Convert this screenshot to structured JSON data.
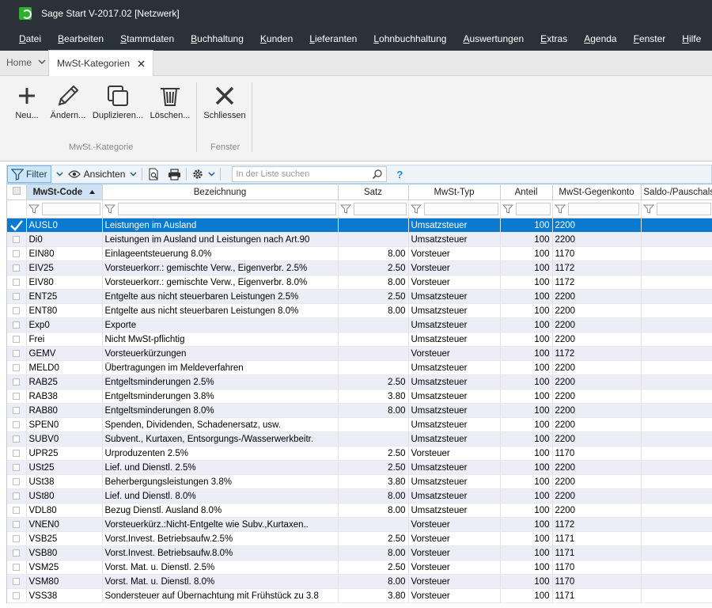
{
  "window": {
    "title": "Sage Start V-2017.02 [Netzwerk]"
  },
  "menu": [
    "Datei",
    "Bearbeiten",
    "Stammdaten",
    "Buchhaltung",
    "Kunden",
    "Lieferanten",
    "Lohnbuchhaltung",
    "Auswertungen",
    "Extras",
    "Agenda",
    "Fenster",
    "Hilfe"
  ],
  "tabs": {
    "home": "Home",
    "active": "MwSt-Kategorien"
  },
  "ribbon": {
    "new_label": "Neu...",
    "edit_label": "Ändern...",
    "duplicate_label": "Duplizieren...",
    "delete_label": "Löschen...",
    "close_label": "Schliessen",
    "group1": "MwSt.-Kategorie",
    "group2": "Fenster"
  },
  "toolbar": {
    "filter_label": "Filter",
    "views_label": "Ansichten",
    "search_placeholder": "In der Liste suchen",
    "help": "?"
  },
  "columns": [
    "MwSt-Code",
    "Bezeichnung",
    "Satz",
    "MwSt-Typ",
    "Anteil",
    "MwSt-Gegenkonto",
    "Saldo-/Pauschalst"
  ],
  "rows": [
    {
      "code": "AUSL0",
      "desc": "Leistungen im Ausland",
      "rate": "",
      "type": "Umsatzsteuer",
      "share": "100",
      "account": "2200"
    },
    {
      "code": "Di0",
      "desc": "Leistungen im Ausland und Leistungen nach Art.90",
      "rate": "",
      "type": "Umsatzsteuer",
      "share": "100",
      "account": "2200"
    },
    {
      "code": "EIN80",
      "desc": "Einlageentsteuerung 8.0%",
      "rate": "8.00",
      "type": "Vorsteuer",
      "share": "100",
      "account": "1170"
    },
    {
      "code": "EIV25",
      "desc": "Vorsteuerkorr.: gemischte Verw., Eigenverbr. 2.5%",
      "rate": "2.50",
      "type": "Vorsteuer",
      "share": "100",
      "account": "1172"
    },
    {
      "code": "EIV80",
      "desc": "Vorsteuerkorr.: gemischte Verw., Eigenverbr. 8.0%",
      "rate": "8.00",
      "type": "Vorsteuer",
      "share": "100",
      "account": "1172"
    },
    {
      "code": "ENT25",
      "desc": "Entgelte aus nicht steuerbaren Leistungen 2.5%",
      "rate": "2.50",
      "type": "Umsatzsteuer",
      "share": "100",
      "account": "2200"
    },
    {
      "code": "ENT80",
      "desc": "Entgelte aus nicht steuerbaren Leistungen 8.0%",
      "rate": "8.00",
      "type": "Umsatzsteuer",
      "share": "100",
      "account": "2200"
    },
    {
      "code": "Exp0",
      "desc": "Exporte",
      "rate": "",
      "type": "Umsatzsteuer",
      "share": "100",
      "account": "2200"
    },
    {
      "code": "Frei",
      "desc": "Nicht MwSt-pflichtig",
      "rate": "",
      "type": "Umsatzsteuer",
      "share": "100",
      "account": "2200"
    },
    {
      "code": "GEMV",
      "desc": "Vorsteuerkürzungen",
      "rate": "",
      "type": "Vorsteuer",
      "share": "100",
      "account": "1172"
    },
    {
      "code": "MELD0",
      "desc": "Übertragungen im Meldeverfahren",
      "rate": "",
      "type": "Umsatzsteuer",
      "share": "100",
      "account": "2200"
    },
    {
      "code": "RAB25",
      "desc": "Entgeltsminderungen 2.5%",
      "rate": "2.50",
      "type": "Umsatzsteuer",
      "share": "100",
      "account": "2200"
    },
    {
      "code": "RAB38",
      "desc": "Entgeltsminderungen 3.8%",
      "rate": "3.80",
      "type": "Umsatzsteuer",
      "share": "100",
      "account": "2200"
    },
    {
      "code": "RAB80",
      "desc": "Entgeltsminderungen 8.0%",
      "rate": "8.00",
      "type": "Umsatzsteuer",
      "share": "100",
      "account": "2200"
    },
    {
      "code": "SPEN0",
      "desc": "Spenden, Dividenden, Schadenersatz, usw.",
      "rate": "",
      "type": "Umsatzsteuer",
      "share": "100",
      "account": "2200"
    },
    {
      "code": "SUBV0",
      "desc": "Subvent., Kurtaxen, Entsorgungs-/Wasserwerkbeitr.",
      "rate": "",
      "type": "Umsatzsteuer",
      "share": "100",
      "account": "2200"
    },
    {
      "code": "UPR25",
      "desc": "Urproduzenten 2.5%",
      "rate": "2.50",
      "type": "Vorsteuer",
      "share": "100",
      "account": "1170"
    },
    {
      "code": "USt25",
      "desc": "Lief. und Dienstl. 2.5%",
      "rate": "2.50",
      "type": "Umsatzsteuer",
      "share": "100",
      "account": "2200"
    },
    {
      "code": "USt38",
      "desc": "Beherbergungsleistungen 3.8%",
      "rate": "3.80",
      "type": "Umsatzsteuer",
      "share": "100",
      "account": "2200"
    },
    {
      "code": "USt80",
      "desc": "Lief. und Dienstl. 8.0%",
      "rate": "8.00",
      "type": "Umsatzsteuer",
      "share": "100",
      "account": "2200"
    },
    {
      "code": "VDL80",
      "desc": "Bezug Dienstl. Ausland 8.0%",
      "rate": "8.00",
      "type": "Umsatzsteuer",
      "share": "100",
      "account": "2200"
    },
    {
      "code": "VNEN0",
      "desc": "Vorsteuerkürz.:Nicht-Entgelte wie Subv.,Kurtaxen..",
      "rate": "",
      "type": "Vorsteuer",
      "share": "100",
      "account": "1172"
    },
    {
      "code": "VSB25",
      "desc": "Vorst.Invest. Betriebsaufw.2.5%",
      "rate": "2.50",
      "type": "Vorsteuer",
      "share": "100",
      "account": "1171"
    },
    {
      "code": "VSB80",
      "desc": "Vorst.Invest. Betriebsaufw.8.0%",
      "rate": "8.00",
      "type": "Vorsteuer",
      "share": "100",
      "account": "1171"
    },
    {
      "code": "VSM25",
      "desc": "Vorst. Mat. u. Dienstl. 2.5%",
      "rate": "2.50",
      "type": "Vorsteuer",
      "share": "100",
      "account": "1170"
    },
    {
      "code": "VSM80",
      "desc": "Vorst. Mat. u. Dienstl. 8.0%",
      "rate": "8.00",
      "type": "Vorsteuer",
      "share": "100",
      "account": "1170"
    },
    {
      "code": "VSS38",
      "desc": "Sondersteuer auf Übernachtung mit Frühstück zu 3.8",
      "rate": "3.80",
      "type": "Vorsteuer",
      "share": "100",
      "account": "1171"
    }
  ],
  "selected_row": 0,
  "colors": {
    "titlebar": "#2b3138",
    "selection": "#0a7ad1",
    "alt_row": "#ededf7"
  }
}
